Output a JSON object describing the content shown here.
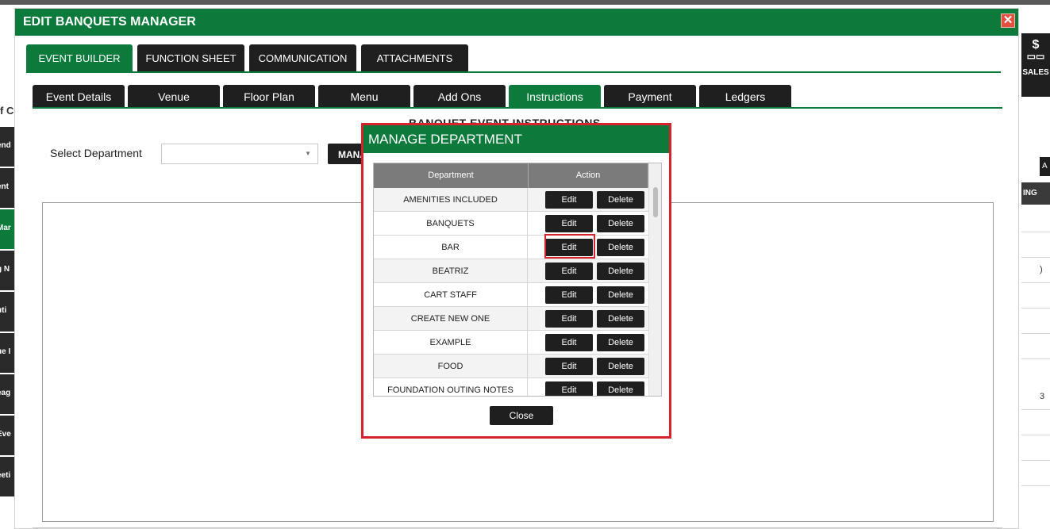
{
  "background": {
    "sales_label": "SALES",
    "sales_icon": "dollar-icon",
    "right_button_label": "A",
    "right_table_header": "ING",
    "right_text_1": ")",
    "right_text_2": "3",
    "left_heading": "f C",
    "left_nav": [
      "end",
      "ent",
      "Mar",
      "g N",
      "uti",
      "ue I",
      "eag",
      "Eve",
      "eeti"
    ]
  },
  "modal": {
    "title": "EDIT BANQUETS MANAGER",
    "close_symbol": "✕",
    "main_tabs": [
      "EVENT BUILDER",
      "FUNCTION SHEET",
      "COMMUNICATION",
      "ATTACHMENTS"
    ],
    "main_tab_active": "EVENT BUILDER",
    "sub_tabs": [
      "Event Details",
      "Venue",
      "Floor Plan",
      "Menu",
      "Add Ons",
      "Instructions",
      "Payment",
      "Ledgers"
    ],
    "sub_tab_active": "Instructions",
    "section_title": "BANQUET EVENT INSTRUCTIONS",
    "select_department_label": "Select Department",
    "select_department_value": "",
    "manage_button": "MANAGE"
  },
  "dialog": {
    "title": "MANAGE DEPARTMENT",
    "columns": [
      "Department",
      "Action"
    ],
    "edit_label": "Edit",
    "delete_label": "Delete",
    "departments": [
      "AMENITIES INCLUDED",
      "BANQUETS",
      "BAR",
      "BEATRIZ",
      "CART STAFF",
      "CREATE NEW ONE",
      "EXAMPLE",
      "FOOD",
      "FOUNDATION OUTING NOTES"
    ],
    "highlighted_row": "BAR",
    "close_label": "Close"
  },
  "colors": {
    "brand_green": "#0b7a3a",
    "dark_button": "#1f1f1f",
    "highlight_red": "#d7232e"
  }
}
